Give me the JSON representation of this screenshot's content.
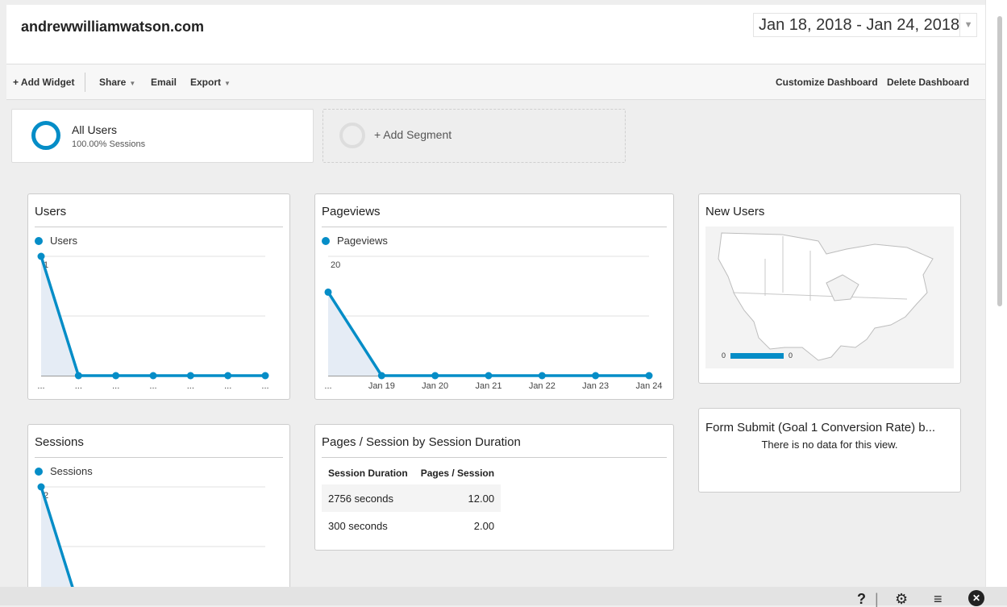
{
  "header": {
    "site_title": "andrewwilliamwatson.com",
    "date_range": "Jan 18, 2018 - Jan 24, 2018"
  },
  "toolbar": {
    "add_widget": "+ Add Widget",
    "share": "Share",
    "email": "Email",
    "export": "Export",
    "customize": "Customize Dashboard",
    "delete": "Delete Dashboard"
  },
  "segments": {
    "active_name": "All Users",
    "active_sub": "100.00% Sessions",
    "add_label": "+ Add Segment"
  },
  "widgets": {
    "users": {
      "title": "Users",
      "legend": "Users"
    },
    "pageviews": {
      "title": "Pageviews",
      "legend": "Pageviews"
    },
    "new_users": {
      "title": "New Users",
      "legend_min": "0",
      "legend_max": "0"
    },
    "sessions": {
      "title": "Sessions",
      "legend": "Sessions"
    },
    "pages_per_session": {
      "title": "Pages / Session by Session Duration",
      "col1": "Session Duration",
      "col2": "Pages / Session",
      "rows": [
        {
          "duration": "2756 seconds",
          "value": "12.00"
        },
        {
          "duration": "300 seconds",
          "value": "2.00"
        }
      ]
    },
    "form_submit": {
      "title": "Form Submit (Goal 1 Conversion Rate) b...",
      "no_data": "There is no data for this view."
    }
  },
  "chart_data": [
    {
      "type": "area",
      "series": [
        {
          "name": "Users",
          "values": [
            1,
            0,
            0,
            0,
            0,
            0,
            0
          ]
        }
      ],
      "ylim": [
        0,
        1
      ],
      "yticks": [
        "1",
        "0.5"
      ],
      "xticks": [
        "...",
        "...",
        "...",
        "...",
        "...",
        "...",
        "..."
      ]
    },
    {
      "type": "area",
      "series": [
        {
          "name": "Pageviews",
          "values": [
            14,
            0,
            0,
            0,
            0,
            0,
            0
          ]
        }
      ],
      "ylim": [
        0,
        20
      ],
      "yticks": [
        "20",
        "10"
      ],
      "xticks": [
        "...",
        "Jan 19",
        "Jan 20",
        "Jan 21",
        "Jan 22",
        "Jan 23",
        "Jan 24"
      ]
    },
    {
      "type": "area",
      "series": [
        {
          "name": "Sessions",
          "values": [
            2,
            0,
            0,
            0,
            0,
            0,
            0
          ]
        }
      ],
      "ylim": [
        0,
        2
      ],
      "yticks": [
        "2",
        "1"
      ],
      "xticks": []
    }
  ],
  "colors": {
    "accent": "#058dc7",
    "fill": "#e5ecf5"
  },
  "icons": [
    "help-icon",
    "gear-icon",
    "menu-icon",
    "close-icon"
  ]
}
